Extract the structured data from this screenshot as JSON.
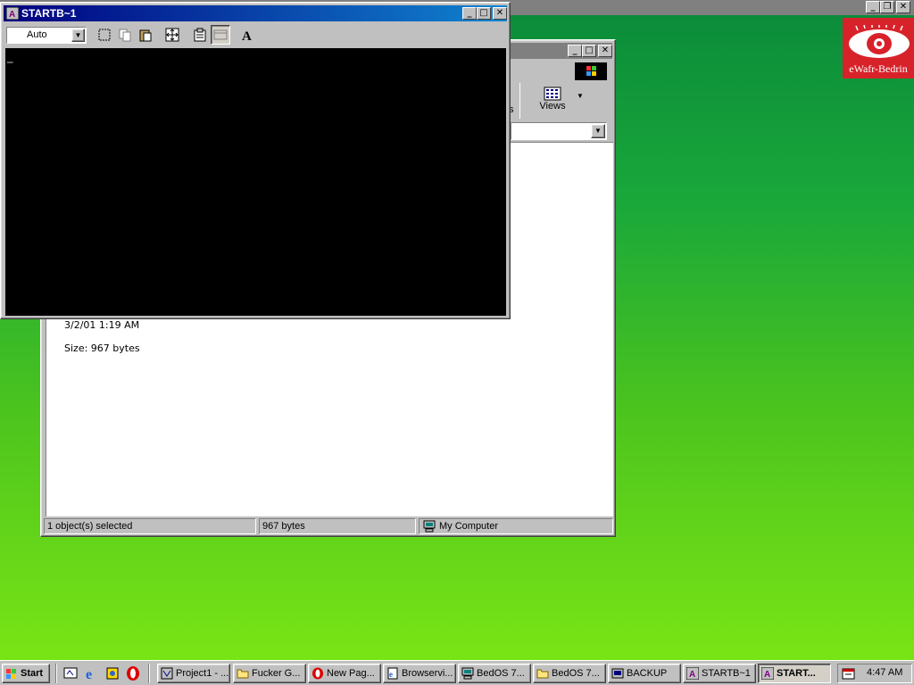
{
  "background_window": {
    "caption_buttons": [
      "_",
      "❐",
      "✕"
    ]
  },
  "logo": {
    "text": "eWafr-Bedrin"
  },
  "explorer": {
    "toolbar": {
      "views_label": "Views",
      "partial_label": "s"
    },
    "info": {
      "date": "3/2/01 1:19 AM",
      "size": "Size: 967 bytes"
    },
    "status": {
      "selected": "1 object(s) selected",
      "bytes": "967 bytes",
      "zone": "My Computer"
    }
  },
  "console": {
    "title": "STARTB~1",
    "font_select": "Auto",
    "cursor": "_"
  },
  "taskbar": {
    "start_label": "Start",
    "buttons": [
      "Project1 - ...",
      "Fucker G...",
      "New Pag...",
      "Browservi...",
      "BedOS 7...",
      "BedOS 7...",
      "BACKUP",
      "STARTB~1",
      "START..."
    ],
    "clock": "4:47 AM"
  },
  "colors": {
    "title_active_start": "#000080",
    "title_active_end": "#1084d0",
    "logo_red": "#d8222a",
    "desktop_green": "#4cc41e"
  }
}
